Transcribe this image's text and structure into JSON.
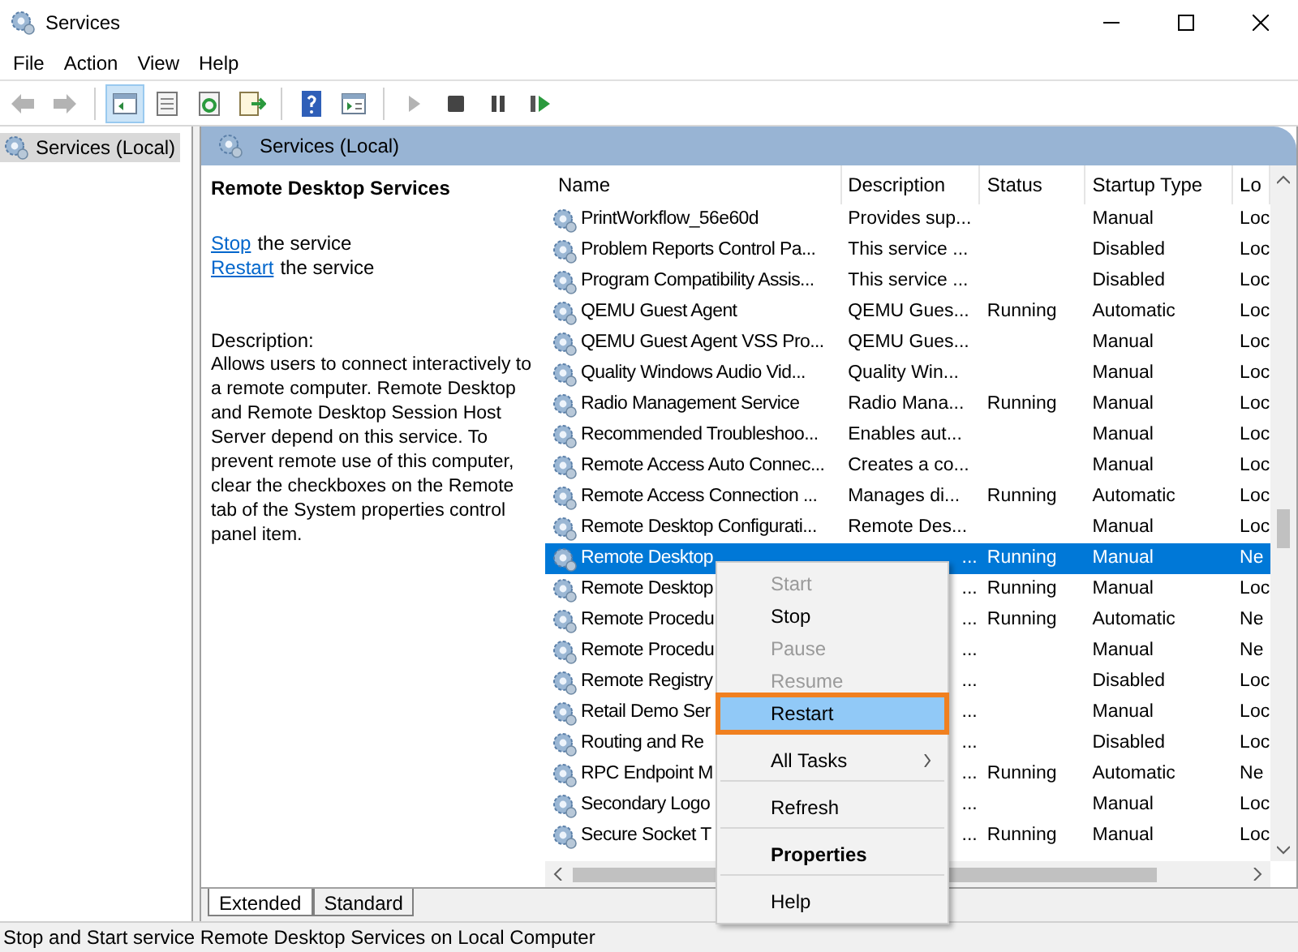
{
  "window": {
    "title": "Services"
  },
  "menu_bar": [
    "File",
    "Action",
    "View",
    "Help"
  ],
  "toolbar": [
    {
      "kind": "back",
      "disabled": true,
      "selected": false
    },
    {
      "kind": "forward",
      "disabled": true,
      "selected": false
    },
    {
      "kind": "tree",
      "disabled": false,
      "selected": true
    },
    {
      "kind": "sheet",
      "disabled": false,
      "selected": false
    },
    {
      "kind": "refresh",
      "disabled": false,
      "selected": false
    },
    {
      "kind": "export",
      "disabled": false,
      "selected": false
    },
    {
      "kind": "help",
      "disabled": false,
      "selected": false
    },
    {
      "kind": "console",
      "disabled": false,
      "selected": false
    },
    {
      "kind": "play",
      "disabled": true,
      "selected": false
    },
    {
      "kind": "stop",
      "disabled": false,
      "selected": false
    },
    {
      "kind": "pause",
      "disabled": false,
      "selected": false
    },
    {
      "kind": "restart",
      "disabled": false,
      "selected": false
    }
  ],
  "tree": {
    "items": [
      {
        "label": "Services (Local)",
        "selected": true
      }
    ]
  },
  "pane_header": "Services (Local)",
  "details": {
    "title": "Remote Desktop Services",
    "actions": [
      {
        "link": "Stop",
        "text": "the service"
      },
      {
        "link": "Restart",
        "text": "the service"
      }
    ],
    "description_label": "Description:",
    "description": "Allows users to connect interactively to a remote computer. Remote Desktop and Remote Desktop Session Host Server depend on this service. To prevent remote use of this computer, clear the checkboxes on the Remote tab of the System properties control panel item."
  },
  "table": {
    "columns": [
      "Name",
      "Description",
      "Status",
      "Startup Type",
      "Lo"
    ],
    "rows": [
      {
        "name": "PrintWorkflow_56e60d",
        "description": "Provides sup...",
        "status": "",
        "startup": "Manual",
        "log": "Loc",
        "selected": false,
        "partly_hidden": false
      },
      {
        "name": "Problem Reports Control Pa...",
        "description": "This service ...",
        "status": "",
        "startup": "Disabled",
        "log": "Loc",
        "selected": false,
        "partly_hidden": false
      },
      {
        "name": "Program Compatibility Assis...",
        "description": "This service ...",
        "status": "",
        "startup": "Disabled",
        "log": "Loc",
        "selected": false,
        "partly_hidden": false
      },
      {
        "name": "QEMU Guest Agent",
        "description": "QEMU Gues...",
        "status": "Running",
        "startup": "Automatic",
        "log": "Loc",
        "selected": false,
        "partly_hidden": false
      },
      {
        "name": "QEMU Guest Agent VSS Pro...",
        "description": "QEMU Gues...",
        "status": "",
        "startup": "Manual",
        "log": "Loc",
        "selected": false,
        "partly_hidden": false
      },
      {
        "name": "Quality Windows Audio Vid...",
        "description": "Quality Win...",
        "status": "",
        "startup": "Manual",
        "log": "Loc",
        "selected": false,
        "partly_hidden": false
      },
      {
        "name": "Radio Management Service",
        "description": "Radio Mana...",
        "status": "Running",
        "startup": "Manual",
        "log": "Loc",
        "selected": false,
        "partly_hidden": false
      },
      {
        "name": "Recommended Troubleshoo...",
        "description": "Enables aut...",
        "status": "",
        "startup": "Manual",
        "log": "Loc",
        "selected": false,
        "partly_hidden": false
      },
      {
        "name": "Remote Access Auto Connec...",
        "description": "Creates a co...",
        "status": "",
        "startup": "Manual",
        "log": "Loc",
        "selected": false,
        "partly_hidden": false
      },
      {
        "name": "Remote Access Connection ...",
        "description": "Manages di...",
        "status": "Running",
        "startup": "Automatic",
        "log": "Loc",
        "selected": false,
        "partly_hidden": false
      },
      {
        "name": "Remote Desktop Configurati...",
        "description": "Remote Des...",
        "status": "",
        "startup": "Manual",
        "log": "Loc",
        "selected": false,
        "partly_hidden": false
      },
      {
        "name": "Remote Desktop",
        "description": "...",
        "status": "Running",
        "startup": "Manual",
        "log": "Ne",
        "selected": true,
        "partly_hidden": true
      },
      {
        "name": "Remote Desktop",
        "description": "...",
        "status": "Running",
        "startup": "Manual",
        "log": "Loc",
        "selected": false,
        "partly_hidden": true
      },
      {
        "name": "Remote Procedu",
        "description": "...",
        "status": "Running",
        "startup": "Automatic",
        "log": "Ne",
        "selected": false,
        "partly_hidden": true
      },
      {
        "name": "Remote Procedu",
        "description": "...",
        "status": "",
        "startup": "Manual",
        "log": "Ne",
        "selected": false,
        "partly_hidden": true
      },
      {
        "name": "Remote Registry",
        "description": "...",
        "status": "",
        "startup": "Disabled",
        "log": "Loc",
        "selected": false,
        "partly_hidden": true
      },
      {
        "name": "Retail Demo Ser",
        "description": "...",
        "status": "",
        "startup": "Manual",
        "log": "Loc",
        "selected": false,
        "partly_hidden": true
      },
      {
        "name": "Routing and Re",
        "description": "...",
        "status": "",
        "startup": "Disabled",
        "log": "Loc",
        "selected": false,
        "partly_hidden": true
      },
      {
        "name": "RPC Endpoint M",
        "description": "...",
        "status": "Running",
        "startup": "Automatic",
        "log": "Ne",
        "selected": false,
        "partly_hidden": true
      },
      {
        "name": "Secondary Logo",
        "description": "...",
        "status": "",
        "startup": "Manual",
        "log": "Loc",
        "selected": false,
        "partly_hidden": true
      },
      {
        "name": "Secure Socket T",
        "description": "...",
        "status": "Running",
        "startup": "Manual",
        "log": "Loc",
        "selected": false,
        "partly_hidden": true
      }
    ]
  },
  "view_tabs": [
    {
      "label": "Extended",
      "selected": true
    },
    {
      "label": "Standard",
      "selected": false
    }
  ],
  "status_bar": "Stop and Start service Remote Desktop Services on Local Computer",
  "context_menu": [
    {
      "label": "Start",
      "kind": "item",
      "disabled": true,
      "selected": false,
      "bold": false,
      "separator_before": false
    },
    {
      "label": "Stop",
      "kind": "item",
      "disabled": false,
      "selected": false,
      "bold": false,
      "separator_before": false
    },
    {
      "label": "Pause",
      "kind": "item",
      "disabled": true,
      "selected": false,
      "bold": false,
      "separator_before": false
    },
    {
      "label": "Resume",
      "kind": "item",
      "disabled": true,
      "selected": false,
      "bold": false,
      "separator_before": false
    },
    {
      "label": "Restart",
      "kind": "item",
      "disabled": false,
      "selected": true,
      "bold": false,
      "separator_before": false
    },
    {
      "label": "All Tasks",
      "kind": "submenu",
      "disabled": false,
      "selected": false,
      "bold": false,
      "separator_before": true
    },
    {
      "label": "Refresh",
      "kind": "item",
      "disabled": false,
      "selected": false,
      "bold": false,
      "separator_before": true
    },
    {
      "label": "Properties",
      "kind": "item",
      "disabled": false,
      "selected": false,
      "bold": true,
      "separator_before": true
    },
    {
      "label": "Help",
      "kind": "item",
      "disabled": false,
      "selected": false,
      "bold": false,
      "separator_before": true
    }
  ]
}
